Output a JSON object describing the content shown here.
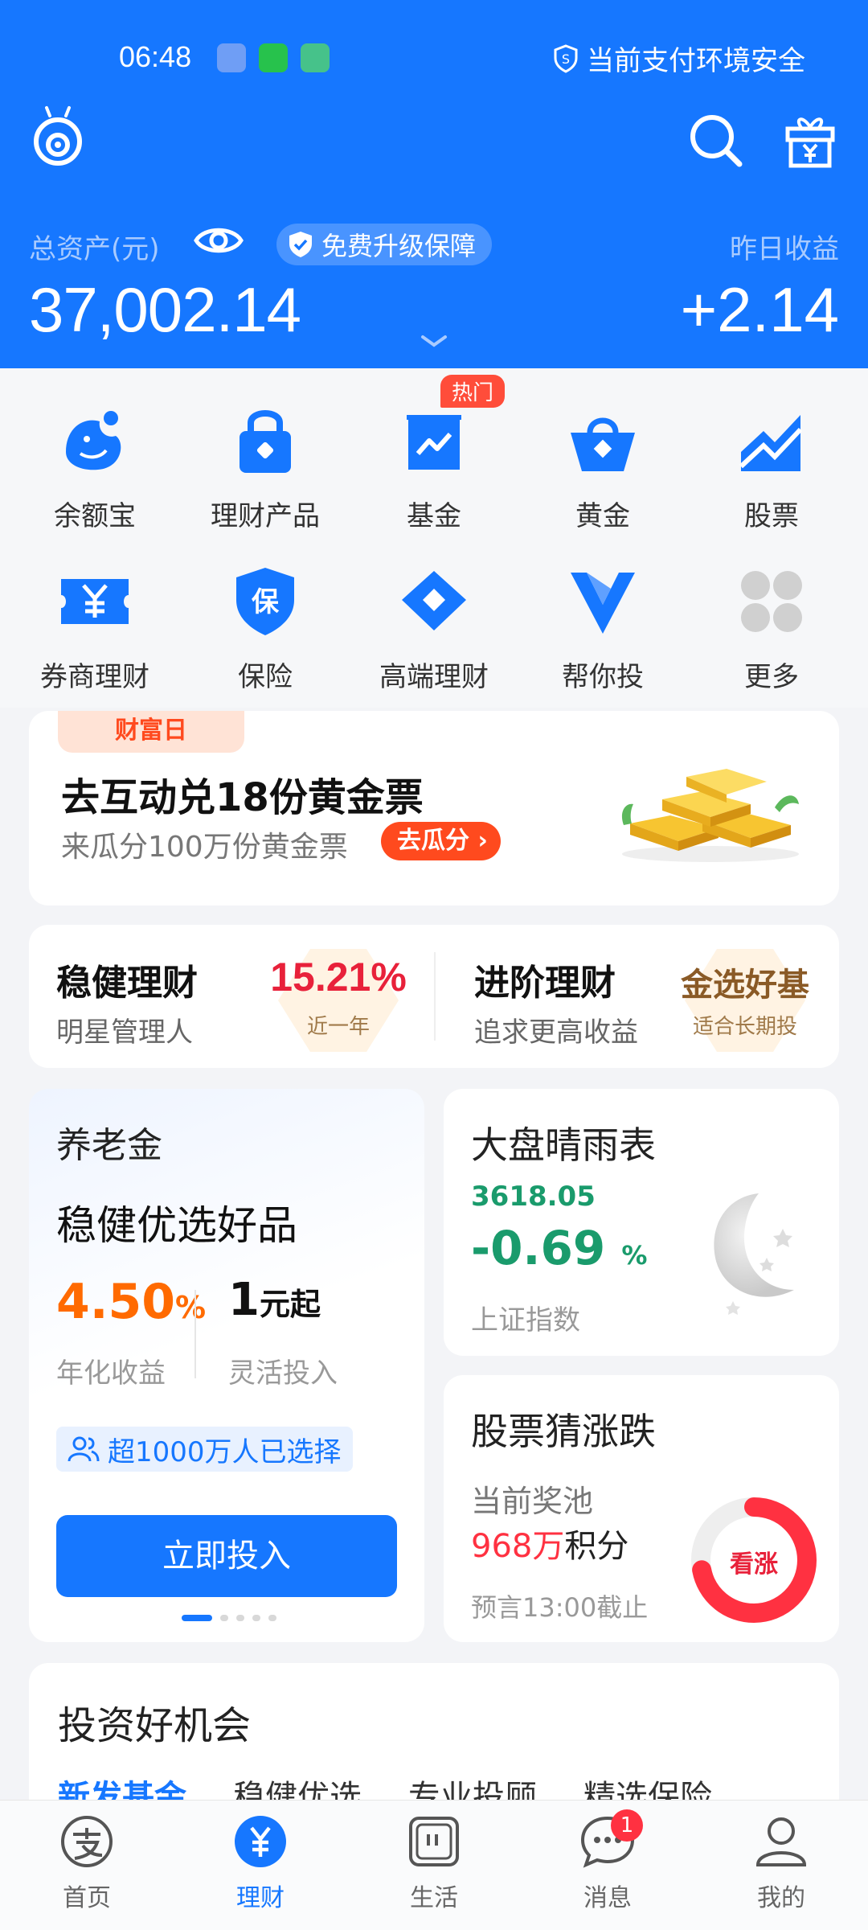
{
  "status": {
    "time": "06:48",
    "safety_text": "当前支付环境安全"
  },
  "header": {
    "assets_label": "总资产(元)",
    "upgrade_label": "免费升级保障",
    "yesterday_label": "昨日收益",
    "total_assets": "37,002.14",
    "yesterday_income": "+2.14"
  },
  "grid": {
    "hot_badge": "热门",
    "items": [
      {
        "label": "余额宝",
        "icon": "yuebao-icon"
      },
      {
        "label": "理财产品",
        "icon": "lock-bag-icon"
      },
      {
        "label": "基金",
        "icon": "fund-chart-icon"
      },
      {
        "label": "黄金",
        "icon": "gold-bag-icon"
      },
      {
        "label": "股票",
        "icon": "stock-trend-icon"
      },
      {
        "label": "券商理财",
        "icon": "yen-ticket-icon"
      },
      {
        "label": "保险",
        "icon": "shield-bao-icon"
      },
      {
        "label": "高端理财",
        "icon": "diamond-icon"
      },
      {
        "label": "帮你投",
        "icon": "v-logo-icon"
      },
      {
        "label": "更多",
        "icon": "more-grid-icon"
      }
    ]
  },
  "promo": {
    "tag": "财富日",
    "title": "去互动兑18份黄金票",
    "subtitle": "来瓜分100万份黄金票",
    "button": "去瓜分 ›"
  },
  "finance": {
    "left": {
      "title": "稳健理财",
      "subtitle": "明星管理人",
      "value": "15.21%",
      "value_label": "近一年"
    },
    "right": {
      "title": "进阶理财",
      "subtitle": "追求更高收益",
      "value": "金选好基",
      "value_label": "适合长期投"
    }
  },
  "pension": {
    "title": "养老金",
    "headline": "稳健优选好品",
    "rate": "4.50",
    "rate_unit": "%",
    "rate_label": "年化收益",
    "min_amount": "1",
    "min_unit": "元起",
    "min_label": "灵活投入",
    "users_text": "超1000万人已选择",
    "button": "立即投入"
  },
  "market": {
    "title": "大盘晴雨表",
    "index_value": "3618.05",
    "change": "-0.69",
    "change_unit": "%",
    "index_name": "上证指数"
  },
  "guess": {
    "title": "股票猜涨跌",
    "pool_label": "当前奖池",
    "points_amount": "968万",
    "points_unit": "积分",
    "deadline": "预言13:00截止",
    "ring_label": "看涨",
    "rise_share": 0.72
  },
  "opportunity": {
    "title": "投资好机会",
    "tabs": [
      "新发基金",
      "稳健优选",
      "专业投顾",
      "精选保险"
    ]
  },
  "tabbar": {
    "items": [
      {
        "label": "首页",
        "icon": "alipay-home-icon"
      },
      {
        "label": "理财",
        "icon": "yen-circle-icon"
      },
      {
        "label": "生活",
        "icon": "life-icon"
      },
      {
        "label": "消息",
        "icon": "chat-icon"
      },
      {
        "label": "我的",
        "icon": "person-icon"
      }
    ],
    "message_badge": "1"
  },
  "colors": {
    "brand_blue": "#1677ff",
    "rise_red": "#ff3141",
    "fall_green": "#1a9b6c",
    "accent_orange": "#ff6a00"
  }
}
